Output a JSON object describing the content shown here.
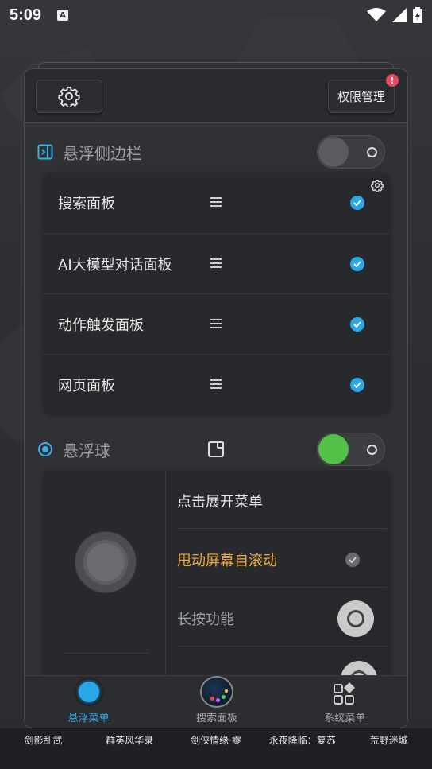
{
  "status_bar": {
    "time": "5:09",
    "a_icon": "A"
  },
  "panel": {
    "topbar": {
      "settings_icon": "gear-icon",
      "permission_label": "权限管理",
      "permission_badge": "!"
    },
    "sidebar_section": {
      "title": "悬浮侧边栏",
      "toggle_on": false,
      "items": [
        {
          "label": "搜索面板",
          "checked": true
        },
        {
          "label": "AI大模型对话面板",
          "checked": true
        },
        {
          "label": "动作触发面板",
          "checked": true
        },
        {
          "label": "网页面板",
          "checked": true
        }
      ]
    },
    "ball_section": {
      "title": "悬浮球",
      "toggle_on": true,
      "options": [
        {
          "label": "点击展开菜单"
        },
        {
          "label": "甩动屏幕自滚动",
          "color": "#f0a93a",
          "checked": true
        },
        {
          "label": "长按功能"
        }
      ]
    },
    "bottom_nav": [
      {
        "label": "悬浮菜单",
        "active": true
      },
      {
        "label": "搜索面板",
        "active": false
      },
      {
        "label": "系统菜单",
        "active": false
      }
    ]
  },
  "taskbar": [
    "剑影乱武",
    "群英风华录",
    "剑侠情缘·零",
    "永夜降临：复苏",
    "荒野迷城"
  ],
  "colors": {
    "accent": "#2aa7e8",
    "toggle_on": "#52c348",
    "warning": "#f0a93a",
    "badge": "#e64a5f"
  }
}
